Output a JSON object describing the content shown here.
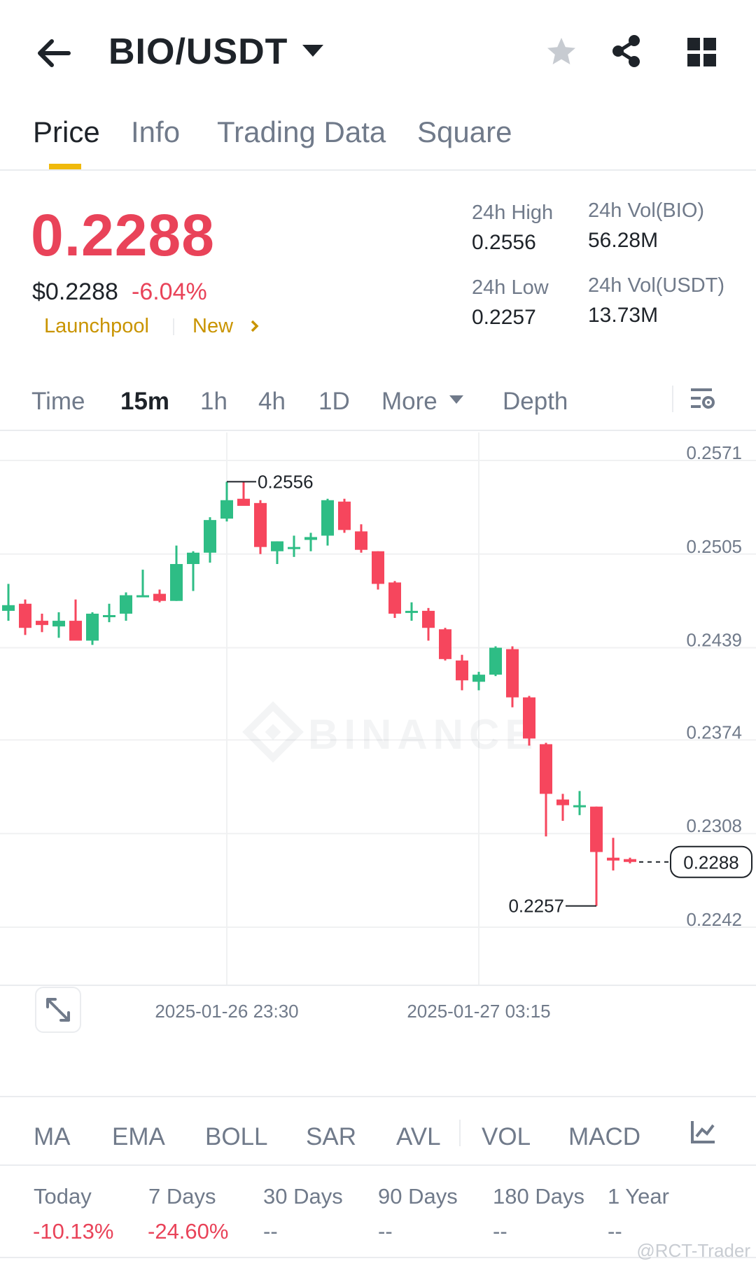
{
  "header": {
    "pair": "BIO/USDT",
    "back_icon": "arrow-left-icon",
    "favorite_icon": "star-icon",
    "share_icon": "share-icon",
    "grid_icon": "grid-icon"
  },
  "tabs": [
    {
      "label": "Price"
    },
    {
      "label": "Info"
    },
    {
      "label": "Trading Data"
    },
    {
      "label": "Square"
    }
  ],
  "price": {
    "last": "0.2288",
    "usd": "$0.2288",
    "change": "-6.04%",
    "launchpool": "Launchpool",
    "new": "New",
    "stats": {
      "high_label": "24h High",
      "high": "0.2556",
      "low_label": "24h Low",
      "low": "0.2257",
      "vol_base_label": "24h Vol(BIO)",
      "vol_base": "56.28M",
      "vol_quote_label": "24h Vol(USDT)",
      "vol_quote": "13.73M"
    }
  },
  "timeframes": {
    "items": [
      "Time",
      "15m",
      "1h",
      "4h",
      "1D"
    ],
    "active": "15m",
    "more": "More",
    "depth": "Depth"
  },
  "chart_data": {
    "type": "candlestick",
    "interval": "15m",
    "y_ticks": [
      "0.2571",
      "0.2505",
      "0.2439",
      "0.2374",
      "0.2308",
      "0.2242"
    ],
    "ylim": [
      0.2242,
      0.2571
    ],
    "x_ticks": [
      "2025-01-26 23:30",
      "2025-01-27 03:15"
    ],
    "high_marker": "0.2556",
    "low_marker": "0.2257",
    "last_price_label": "0.2288",
    "watermark": "BINANCE",
    "colors": {
      "up": "#2ebd85",
      "down": "#f6465d",
      "grid": "#f0f1f2",
      "text": "#707a8a"
    },
    "candles": [
      {
        "o": 0.2465,
        "h": 0.2484,
        "l": 0.2458,
        "c": 0.2469
      },
      {
        "o": 0.247,
        "h": 0.2473,
        "l": 0.2448,
        "c": 0.2453
      },
      {
        "o": 0.2458,
        "h": 0.2463,
        "l": 0.245,
        "c": 0.2455
      },
      {
        "o": 0.2454,
        "h": 0.2464,
        "l": 0.2446,
        "c": 0.2458
      },
      {
        "o": 0.2458,
        "h": 0.2473,
        "l": 0.2446,
        "c": 0.2444
      },
      {
        "o": 0.2444,
        "h": 0.2464,
        "l": 0.2441,
        "c": 0.2463
      },
      {
        "o": 0.2462,
        "h": 0.247,
        "l": 0.2457,
        "c": 0.2462
      },
      {
        "o": 0.2463,
        "h": 0.2478,
        "l": 0.2458,
        "c": 0.2476
      },
      {
        "o": 0.2476,
        "h": 0.2494,
        "l": 0.2475,
        "c": 0.2476
      },
      {
        "o": 0.2477,
        "h": 0.248,
        "l": 0.2471,
        "c": 0.2472
      },
      {
        "o": 0.2472,
        "h": 0.2511,
        "l": 0.2472,
        "c": 0.2498
      },
      {
        "o": 0.2498,
        "h": 0.2507,
        "l": 0.2479,
        "c": 0.2506
      },
      {
        "o": 0.2506,
        "h": 0.2531,
        "l": 0.2499,
        "c": 0.2529
      },
      {
        "o": 0.253,
        "h": 0.2556,
        "l": 0.2528,
        "c": 0.2543
      },
      {
        "o": 0.2544,
        "h": 0.2556,
        "l": 0.2541,
        "c": 0.2539
      },
      {
        "o": 0.2541,
        "h": 0.2543,
        "l": 0.2505,
        "c": 0.251
      },
      {
        "o": 0.2507,
        "h": 0.2514,
        "l": 0.2498,
        "c": 0.2514
      },
      {
        "o": 0.2509,
        "h": 0.2518,
        "l": 0.2503,
        "c": 0.251
      },
      {
        "o": 0.2515,
        "h": 0.252,
        "l": 0.2507,
        "c": 0.2517
      },
      {
        "o": 0.2518,
        "h": 0.2544,
        "l": 0.2511,
        "c": 0.2543
      },
      {
        "o": 0.2542,
        "h": 0.2544,
        "l": 0.252,
        "c": 0.2522
      },
      {
        "o": 0.2521,
        "h": 0.2526,
        "l": 0.2506,
        "c": 0.2508
      },
      {
        "o": 0.2507,
        "h": 0.2507,
        "l": 0.248,
        "c": 0.2484
      },
      {
        "o": 0.2485,
        "h": 0.2486,
        "l": 0.246,
        "c": 0.2463
      },
      {
        "o": 0.2465,
        "h": 0.2471,
        "l": 0.2458,
        "c": 0.2465
      },
      {
        "o": 0.2465,
        "h": 0.2467,
        "l": 0.2444,
        "c": 0.2453
      },
      {
        "o": 0.2452,
        "h": 0.2453,
        "l": 0.243,
        "c": 0.2431
      },
      {
        "o": 0.243,
        "h": 0.2434,
        "l": 0.2409,
        "c": 0.2416
      },
      {
        "o": 0.2415,
        "h": 0.2422,
        "l": 0.2409,
        "c": 0.242
      },
      {
        "o": 0.242,
        "h": 0.244,
        "l": 0.2419,
        "c": 0.2439
      },
      {
        "o": 0.2438,
        "h": 0.244,
        "l": 0.2397,
        "c": 0.2404
      },
      {
        "o": 0.2404,
        "h": 0.2405,
        "l": 0.237,
        "c": 0.2375
      },
      {
        "o": 0.2371,
        "h": 0.2372,
        "l": 0.2306,
        "c": 0.2336
      },
      {
        "o": 0.2332,
        "h": 0.2336,
        "l": 0.2317,
        "c": 0.2328
      },
      {
        "o": 0.2328,
        "h": 0.2338,
        "l": 0.2321,
        "c": 0.2328
      },
      {
        "o": 0.2327,
        "h": 0.2327,
        "l": 0.2257,
        "c": 0.2295
      },
      {
        "o": 0.2291,
        "h": 0.2305,
        "l": 0.2282,
        "c": 0.2289
      },
      {
        "o": 0.229,
        "h": 0.2291,
        "l": 0.2287,
        "c": 0.2288
      }
    ]
  },
  "indicators": [
    "MA",
    "EMA",
    "BOLL",
    "SAR",
    "AVL",
    "VOL",
    "MACD"
  ],
  "indicator_icon": "chart-settings-icon",
  "performance": [
    {
      "label": "Today",
      "value": "-10.13%"
    },
    {
      "label": "7 Days",
      "value": "-24.60%"
    },
    {
      "label": "30 Days",
      "value": "--"
    },
    {
      "label": "90 Days",
      "value": "--"
    },
    {
      "label": "180 Days",
      "value": "--"
    },
    {
      "label": "1 Year",
      "value": "--"
    }
  ],
  "credit": "@RCT-Trader"
}
